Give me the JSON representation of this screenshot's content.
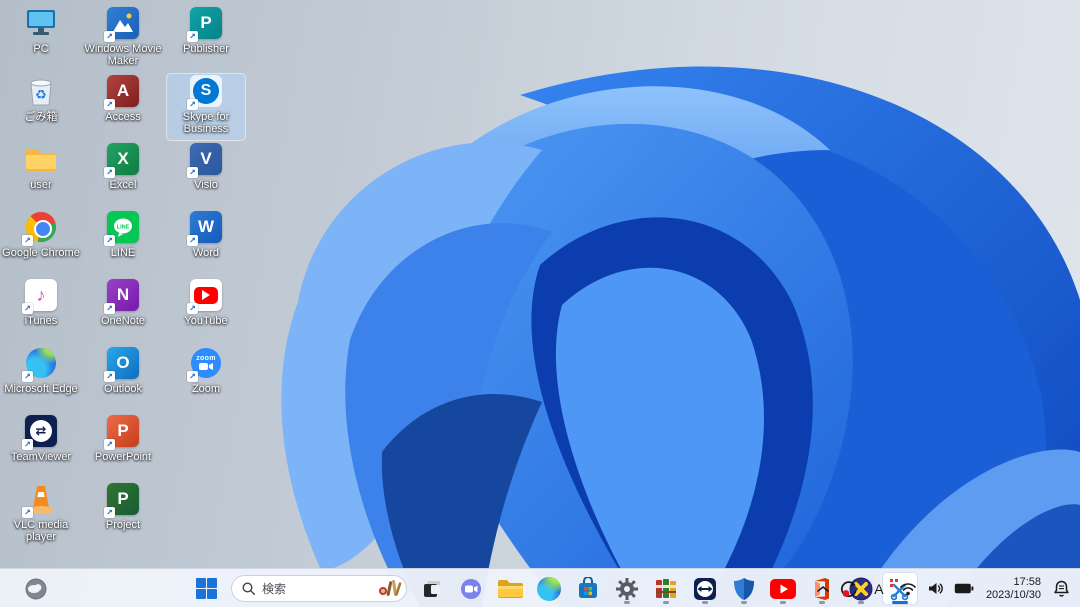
{
  "wallpaper": {
    "style": "windows-11-bloom",
    "background_hex": "#c6cfd9",
    "bloom_blues": [
      "#0b3dae",
      "#1b5fd6",
      "#2f7ce8",
      "#4e97f4",
      "#7cb4f7"
    ]
  },
  "desktop": {
    "icons": [
      {
        "label": "PC",
        "type": "pc",
        "shortcut": false,
        "selected": false
      },
      {
        "label": "ごみ箱",
        "type": "recycle-bin",
        "shortcut": false,
        "selected": false
      },
      {
        "label": "user",
        "type": "folder",
        "shortcut": false,
        "selected": false
      },
      {
        "label": "Google Chrome",
        "type": "chrome",
        "shortcut": true,
        "selected": false
      },
      {
        "label": "iTunes",
        "type": "itunes",
        "letter": "♪",
        "shortcut": true,
        "selected": false
      },
      {
        "label": "Microsoft Edge",
        "type": "edge",
        "shortcut": true,
        "selected": false
      },
      {
        "label": "TeamViewer",
        "type": "teamviewer",
        "letter": "⇄",
        "shortcut": true,
        "selected": false
      },
      {
        "label": "VLC media player",
        "type": "vlc",
        "shortcut": true,
        "selected": false
      },
      {
        "label": "Windows Movie Maker",
        "type": "movie-maker",
        "shortcut": true,
        "selected": false
      },
      {
        "label": "Access",
        "type": "access",
        "letter": "A",
        "shortcut": true,
        "selected": false
      },
      {
        "label": "Excel",
        "type": "excel",
        "letter": "X",
        "shortcut": true,
        "selected": false
      },
      {
        "label": "LINE",
        "type": "line",
        "letter": "LINE",
        "shortcut": true,
        "selected": false
      },
      {
        "label": "OneNote",
        "type": "onenote",
        "letter": "N",
        "shortcut": true,
        "selected": false
      },
      {
        "label": "Outlook",
        "type": "outlook",
        "letter": "O",
        "shortcut": true,
        "selected": false
      },
      {
        "label": "PowerPoint",
        "type": "powerpoint",
        "letter": "P",
        "shortcut": true,
        "selected": false
      },
      {
        "label": "Project",
        "type": "project",
        "letter": "P",
        "shortcut": true,
        "selected": false
      },
      {
        "label": "Publisher",
        "type": "publisher",
        "letter": "P",
        "shortcut": true,
        "selected": false
      },
      {
        "label": "Skype for Business",
        "type": "skype-for-business",
        "letter": "S",
        "shortcut": true,
        "selected": true
      },
      {
        "label": "Visio",
        "type": "visio",
        "letter": "V",
        "shortcut": true,
        "selected": false
      },
      {
        "label": "Word",
        "type": "word",
        "letter": "W",
        "shortcut": true,
        "selected": false
      },
      {
        "label": "YouTube",
        "type": "youtube",
        "shortcut": true,
        "selected": false
      },
      {
        "label": "Zoom",
        "type": "zoom",
        "letter": "zoom",
        "shortcut": true,
        "selected": false
      }
    ]
  },
  "taskbar": {
    "corner_widget_icon": "weather-cloudy-night",
    "start_icon": "windows-logo",
    "search": {
      "placeholder": "検索",
      "trailing_graphic": "search-highlights-tools"
    },
    "pinned_icons": [
      "task-view",
      "chat-teams",
      "file-explorer",
      "microsoft-edge",
      "microsoft-store"
    ],
    "running_icons": [
      "settings-gear",
      "winrar",
      "teamviewer",
      "windows-security-shield",
      "youtube",
      "office",
      "x-sphere-app"
    ],
    "active_icon": "snipping-tool",
    "tray": {
      "chevron": "hidden-icons-chevron",
      "sync_record_icon": "sync-arrow-red-dot",
      "ime_mode": "A",
      "status_icons": [
        "wifi",
        "speaker",
        "battery"
      ],
      "time": "17:58",
      "date": "2023/10/30",
      "notification_icon": "notification-bell"
    }
  }
}
